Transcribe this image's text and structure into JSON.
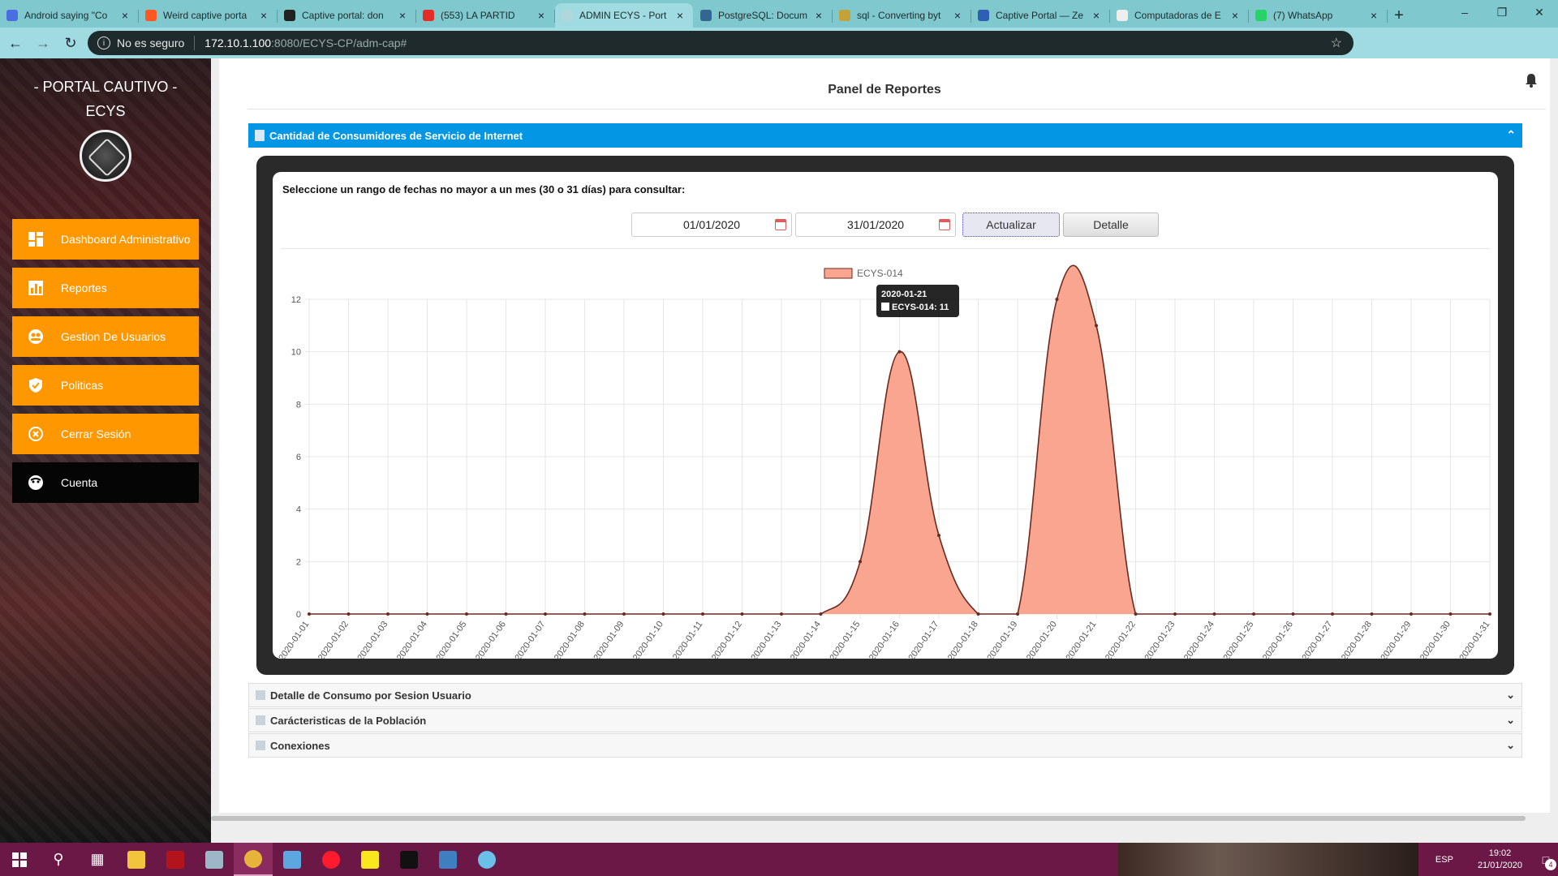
{
  "browser": {
    "tabs": [
      {
        "title": "Android saying \"Co",
        "icon": "mail-icon",
        "color": "#4a6ee0",
        "active": false
      },
      {
        "title": "Weird captive porta",
        "icon": "reddit-icon",
        "color": "#ff5722",
        "active": false
      },
      {
        "title": "Captive portal: don",
        "icon": "github-icon",
        "color": "#222222",
        "active": false
      },
      {
        "title": "(553) LA PARTID",
        "icon": "youtube-icon",
        "color": "#e52d27",
        "active": false
      },
      {
        "title": "ADMIN ECYS - Port",
        "icon": "globe-icon",
        "color": "#b0d8dc",
        "active": true
      },
      {
        "title": "PostgreSQL: Docum",
        "icon": "postgres-icon",
        "color": "#336791",
        "active": false
      },
      {
        "title": "sql - Converting byt",
        "icon": "stackoverflow-icon",
        "color": "#c4a23a",
        "active": false
      },
      {
        "title": "Captive Portal — Ze",
        "icon": "doc-icon",
        "color": "#2f5fb3",
        "active": false
      },
      {
        "title": "Computadoras de E",
        "icon": "store-icon",
        "color": "#eeeeee",
        "active": false
      },
      {
        "title": "(7) WhatsApp",
        "icon": "whatsapp-icon",
        "color": "#25d366",
        "active": false
      }
    ],
    "new_tab": "+",
    "url_security": "No es seguro",
    "url_host": "172.10.1.100",
    "url_path": ":8080/ECYS-CP/adm-cap#"
  },
  "sidebar": {
    "brand_line1": "- PORTAL CAUTIVO -",
    "brand_line2": "ECYS",
    "items": [
      {
        "label": "Dashboard Administrativo",
        "icon": "dashboard-icon"
      },
      {
        "label": "Reportes",
        "icon": "bar-chart-icon"
      },
      {
        "label": "Gestion De Usuarios",
        "icon": "users-icon"
      },
      {
        "label": "Politicas",
        "icon": "shield-check-icon"
      },
      {
        "label": "Cerrar Sesión",
        "icon": "close-circle-icon"
      },
      {
        "label": "Cuenta",
        "icon": "account-icon"
      }
    ]
  },
  "main": {
    "page_title": "Panel de Reportes",
    "panel": {
      "title": "Cantidad de Consumidores de Servicio de Internet",
      "prompt": "Seleccione un rango de fechas no mayor a un mes (30 o 31 días) para consultar:",
      "date_from": "01/01/2020",
      "date_to": "31/01/2020",
      "update_button": "Actualizar",
      "detail_button": "Detalle"
    },
    "accordions": [
      {
        "title": "Detalle de Consumo por Sesion Usuario"
      },
      {
        "title": "Carácteristicas de la Población"
      },
      {
        "title": "Conexiones"
      }
    ]
  },
  "chart_data": {
    "type": "area",
    "x": [
      "2020-01-01",
      "2020-01-02",
      "2020-01-03",
      "2020-01-04",
      "2020-01-05",
      "2020-01-06",
      "2020-01-07",
      "2020-01-08",
      "2020-01-09",
      "2020-01-10",
      "2020-01-11",
      "2020-01-12",
      "2020-01-13",
      "2020-01-14",
      "2020-01-15",
      "2020-01-16",
      "2020-01-17",
      "2020-01-18",
      "2020-01-19",
      "2020-01-20",
      "2020-01-21",
      "2020-01-22",
      "2020-01-23",
      "2020-01-24",
      "2020-01-25",
      "2020-01-26",
      "2020-01-27",
      "2020-01-28",
      "2020-01-29",
      "2020-01-30",
      "2020-01-31"
    ],
    "series": [
      {
        "name": "ECYS-014",
        "values": [
          0,
          0,
          0,
          0,
          0,
          0,
          0,
          0,
          0,
          0,
          0,
          0,
          0,
          0,
          2,
          10,
          3,
          0,
          0,
          12,
          11,
          0,
          0,
          0,
          0,
          0,
          0,
          0,
          0,
          0,
          0
        ],
        "color": "#f9a58f",
        "line_color": "#6b2a20"
      }
    ],
    "yticks": [
      0,
      2,
      4,
      6,
      8,
      10,
      12
    ],
    "ylim": [
      0,
      12
    ],
    "legend": "top-center",
    "grid": true,
    "tooltip": {
      "title": "2020-01-21",
      "label": "ECYS-014: 11"
    }
  },
  "taskbar": {
    "language": "ESP",
    "time": "19:02",
    "date": "21/01/2020",
    "notifications": "4"
  }
}
